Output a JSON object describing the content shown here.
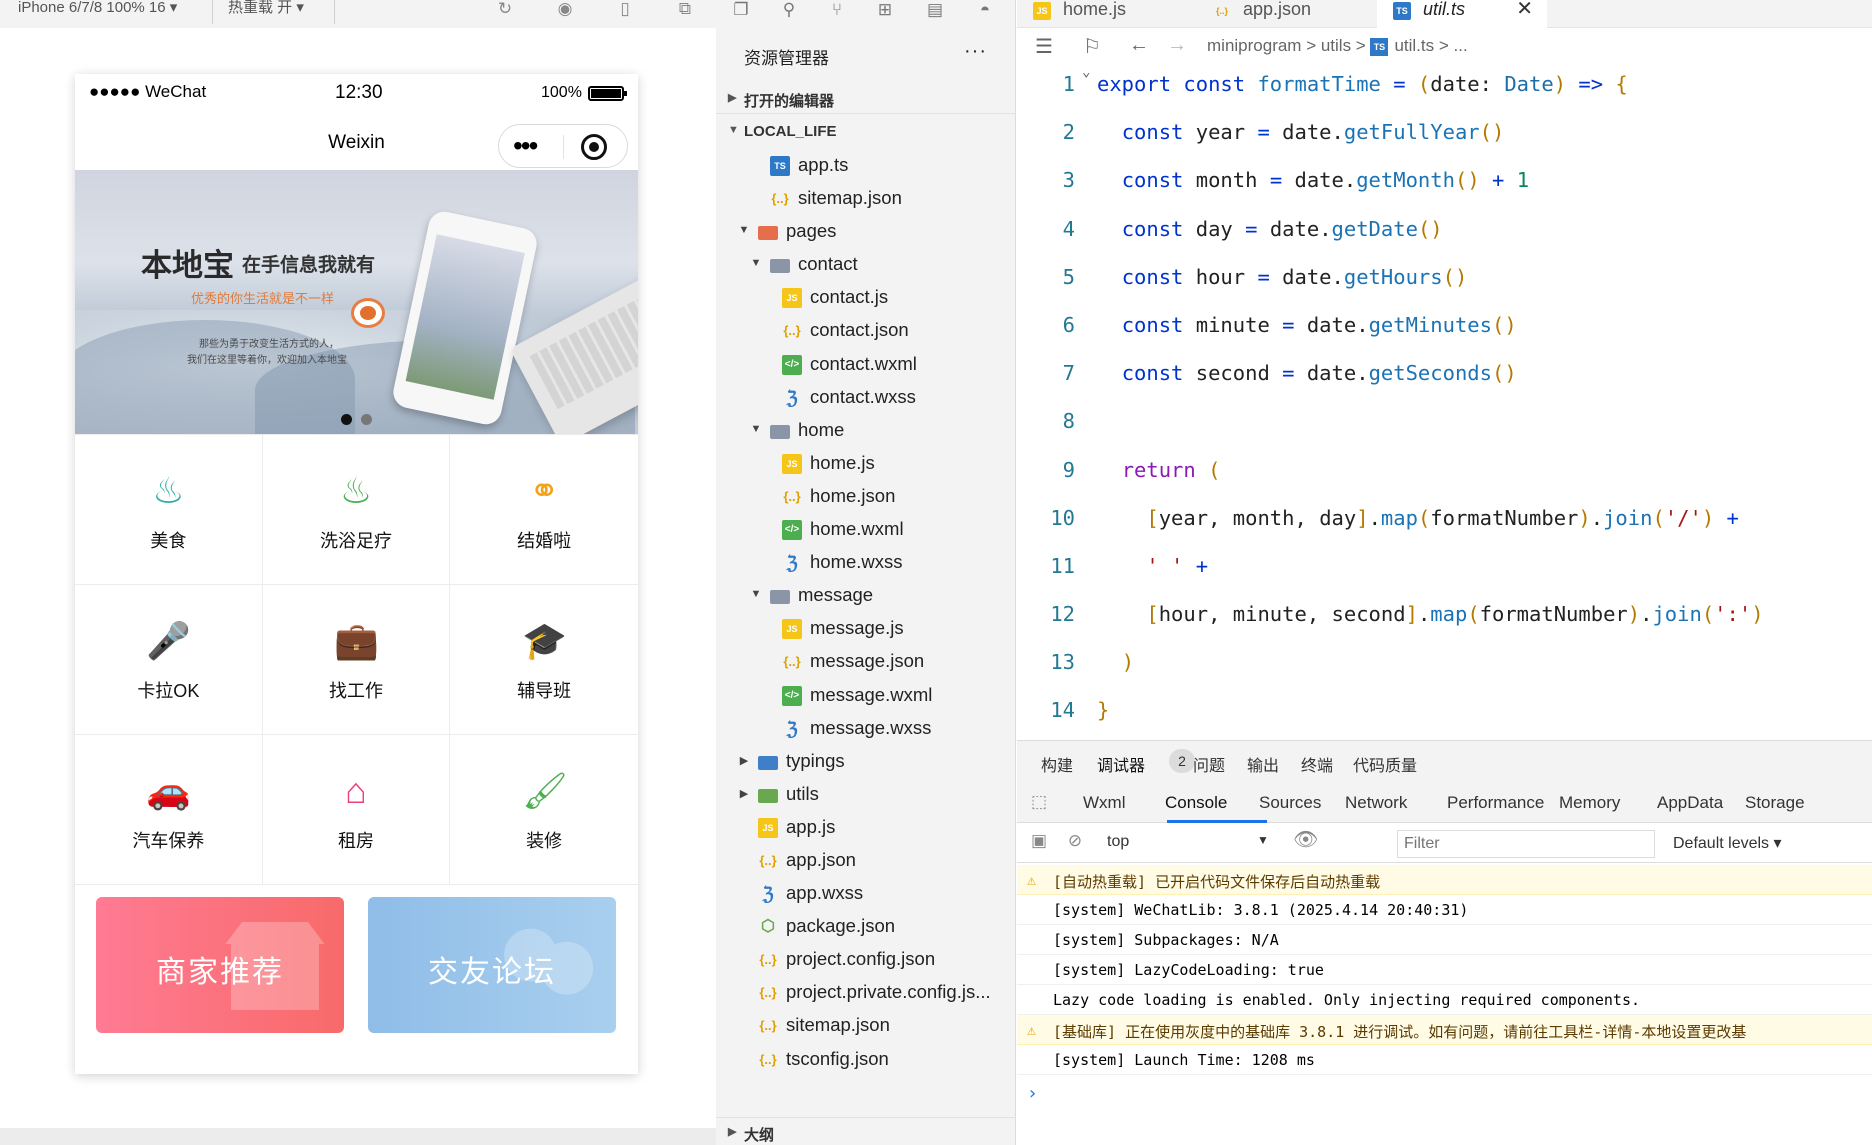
{
  "simulator": {
    "device_label": "iPhone 6/7/8 100% 16 ▾",
    "reload_label": "热重载 开 ▾",
    "status": {
      "carrier": "●●●●● WeChat",
      "time": "12:30",
      "battery": "100%",
      "battery_level": 1.0
    },
    "nav_title": "Weixin",
    "banner": {
      "headline": "本地宝",
      "headline_sub": "在手信息我就有",
      "tagline": "优秀的你生活就是不一样",
      "small1": "那些为勇于改变生活方式的人，",
      "small2": "我们在这里等着你，欢迎加入本地宝",
      "active_dot": 0
    },
    "grid": [
      {
        "label": "美食",
        "icon": "food-cloche-icon",
        "color": "#2bb1a1"
      },
      {
        "label": "洗浴足疗",
        "icon": "bath-icon",
        "color": "#4caf50"
      },
      {
        "label": "结婚啦",
        "icon": "wedding-rings-icon",
        "color": "#f2a31b"
      },
      {
        "label": "卡拉OK",
        "icon": "microphone-icon",
        "color": "#e8543f"
      },
      {
        "label": "找工作",
        "icon": "briefcase-icon",
        "color": "#1e88e5"
      },
      {
        "label": "辅导班",
        "icon": "graduation-cap-icon",
        "color": "#1976d2"
      },
      {
        "label": "汽车保养",
        "icon": "car-service-icon",
        "color": "#1e88e5"
      },
      {
        "label": "租房",
        "icon": "house-icon",
        "color": "#ec407a"
      },
      {
        "label": "装修",
        "icon": "paint-roller-icon",
        "color": "#4caf50"
      }
    ],
    "promo": [
      {
        "label": "商家推荐",
        "from": "#ff7b93",
        "to": "#f86a6a"
      },
      {
        "label": "交友论坛",
        "from": "#8fbde8",
        "to": "#a9cfee"
      }
    ]
  },
  "explorer": {
    "header": "资源管理器",
    "more": "···",
    "open_editors": "打开的编辑器",
    "project": "LOCAL_LIFE",
    "outline": "大纲",
    "tree": [
      {
        "name": "app.ts",
        "type": "ts",
        "depth": 1
      },
      {
        "name": "sitemap.json",
        "type": "json",
        "depth": 1
      },
      {
        "name": "pages",
        "type": "folder-red",
        "depth": 0,
        "open": true
      },
      {
        "name": "contact",
        "type": "folder",
        "depth": 1,
        "open": true
      },
      {
        "name": "contact.js",
        "type": "js",
        "depth": 2
      },
      {
        "name": "contact.json",
        "type": "json",
        "depth": 2
      },
      {
        "name": "contact.wxml",
        "type": "wxml",
        "depth": 2
      },
      {
        "name": "contact.wxss",
        "type": "wxss",
        "depth": 2
      },
      {
        "name": "home",
        "type": "folder",
        "depth": 1,
        "open": true
      },
      {
        "name": "home.js",
        "type": "js",
        "depth": 2
      },
      {
        "name": "home.json",
        "type": "json",
        "depth": 2
      },
      {
        "name": "home.wxml",
        "type": "wxml",
        "depth": 2
      },
      {
        "name": "home.wxss",
        "type": "wxss",
        "depth": 2
      },
      {
        "name": "message",
        "type": "folder",
        "depth": 1,
        "open": true
      },
      {
        "name": "message.js",
        "type": "js",
        "depth": 2
      },
      {
        "name": "message.json",
        "type": "json",
        "depth": 2
      },
      {
        "name": "message.wxml",
        "type": "wxml",
        "depth": 2
      },
      {
        "name": "message.wxss",
        "type": "wxss",
        "depth": 2
      },
      {
        "name": "typings",
        "type": "folder-blue",
        "depth": 0,
        "open": false
      },
      {
        "name": "utils",
        "type": "folder-green",
        "depth": 0,
        "open": false
      },
      {
        "name": "app.js",
        "type": "js",
        "depth": 0
      },
      {
        "name": "app.json",
        "type": "json",
        "depth": 0
      },
      {
        "name": "app.wxss",
        "type": "wxss",
        "depth": 0
      },
      {
        "name": "package.json",
        "type": "pkg",
        "depth": 0
      },
      {
        "name": "project.config.json",
        "type": "json",
        "depth": 0
      },
      {
        "name": "project.private.config.js...",
        "type": "json",
        "depth": 0
      },
      {
        "name": "sitemap.json",
        "type": "json",
        "depth": 0
      },
      {
        "name": "tsconfig.json",
        "type": "json",
        "depth": 0
      }
    ]
  },
  "editor": {
    "tabs": [
      {
        "name": "home.js",
        "type": "js",
        "active": false
      },
      {
        "name": "app.json",
        "type": "json",
        "active": false
      },
      {
        "name": "util.ts",
        "type": "ts",
        "active": true
      }
    ],
    "close_glyph": "✕",
    "breadcrumbs": "miniprogram > utils > ",
    "breadcrumb_file": "util.ts",
    "breadcrumb_tail": " > ...",
    "lines": [
      "export const formatTime = (date: Date) => {",
      "  const year = date.getFullYear()",
      "  const month = date.getMonth() + 1",
      "  const day = date.getDate()",
      "  const hour = date.getHours()",
      "  const minute = date.getMinutes()",
      "  const second = date.getSeconds()",
      "",
      "  return (",
      "    [year, month, day].map(formatNumber).join('/') +",
      "    ' ' +",
      "    [hour, minute, second].map(formatNumber).join(':')",
      "  )",
      "}"
    ]
  },
  "devtools": {
    "top_tabs": [
      "构建",
      "调试器",
      "问题",
      "输出",
      "终端",
      "代码质量"
    ],
    "badge": "2",
    "panel_tabs": [
      "Wxml",
      "Console",
      "Sources",
      "Network",
      "Performance",
      "Memory",
      "AppData",
      "Storage"
    ],
    "active_panel": "Console",
    "context": "top",
    "filter_placeholder": "Filter",
    "levels": "Default levels ▾",
    "messages": [
      {
        "level": "warn",
        "text": "[自动热重载] 已开启代码文件保存后自动热重载"
      },
      {
        "level": "info",
        "text": "[system] WeChatLib: 3.8.1 (2025.4.14 20:40:31)"
      },
      {
        "level": "info",
        "text": "[system] Subpackages: N/A"
      },
      {
        "level": "info",
        "text": "[system] LazyCodeLoading: true"
      },
      {
        "level": "info",
        "text": "Lazy code loading is enabled. Only injecting required components."
      },
      {
        "level": "warn",
        "text": "[基础库] 正在使用灰度中的基础库 3.8.1 进行调试。如有问题，请前往工具栏-详情-本地设置更改基"
      },
      {
        "level": "info",
        "text": "[system] Launch Time: 1208 ms"
      }
    ],
    "prompt": "›"
  }
}
